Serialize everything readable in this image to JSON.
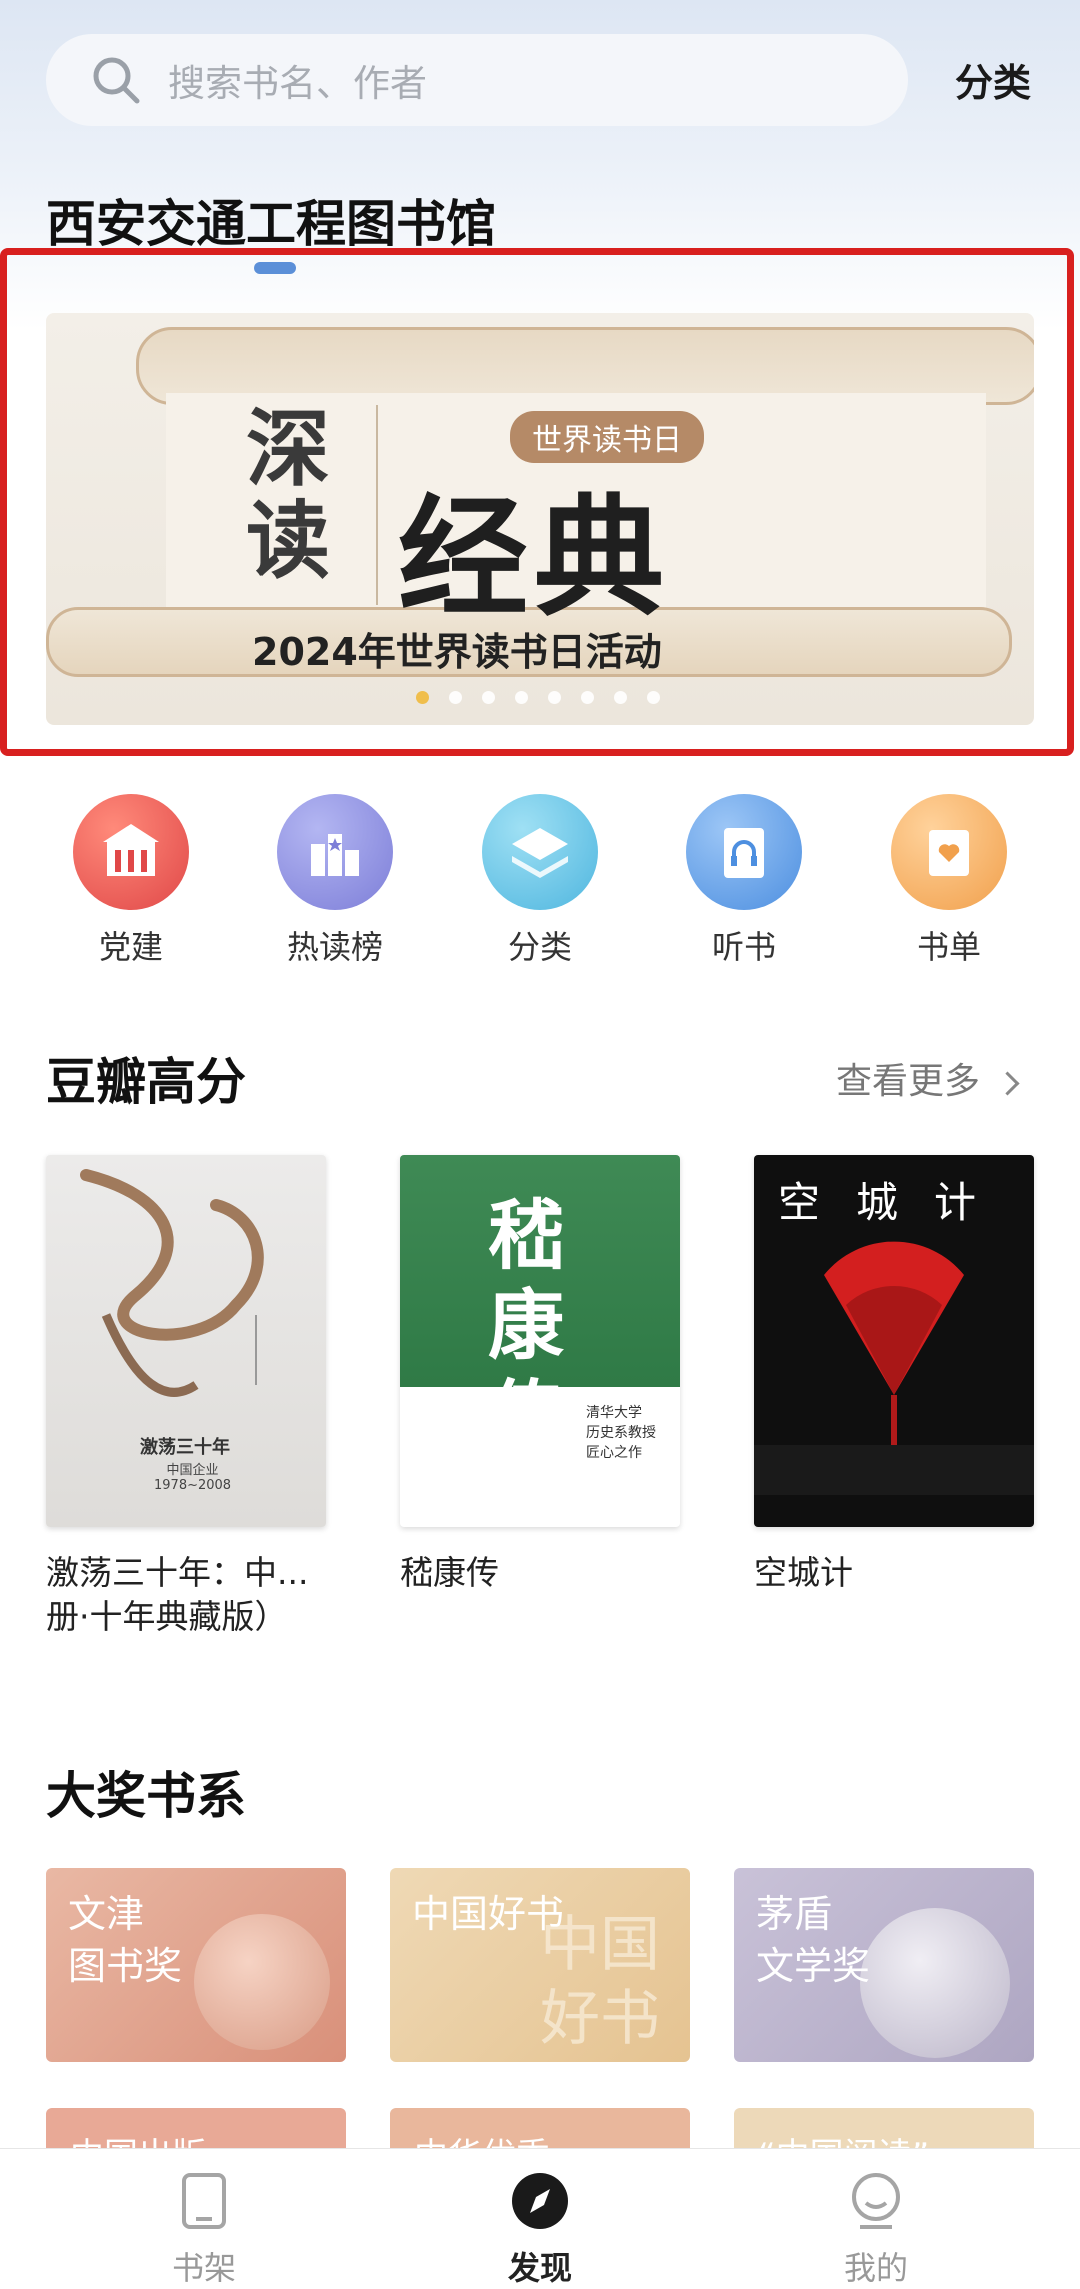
{
  "search": {
    "placeholder": "搜索书名、作者"
  },
  "header": {
    "category_link": "分类",
    "library_title": "西安交通工程图书馆"
  },
  "banner": {
    "vertical_text": "深读",
    "headline": "经典",
    "badge": "世界读书日",
    "caption": "2024年世界读书日活动",
    "page_dots": 8,
    "active_dot": 0
  },
  "shortcuts": [
    {
      "label": "党建",
      "icon": "party-building-icon",
      "color": "#e04848"
    },
    {
      "label": "热读榜",
      "icon": "hot-ranking-icon",
      "color": "#7d7ed8"
    },
    {
      "label": "分类",
      "icon": "layers-icon",
      "color": "#4fb6df"
    },
    {
      "label": "听书",
      "icon": "audiobook-icon",
      "color": "#4d8fe0"
    },
    {
      "label": "书单",
      "icon": "booklist-icon",
      "color": "#f1a04c"
    }
  ],
  "douban": {
    "title": "豆瓣高分",
    "more": "查看更多",
    "books": [
      {
        "title": "激荡三十年：中...\n册·十年典藏版）",
        "cover_text": "激荡三十年",
        "cover_sub": "中国企业\n1978~2008"
      },
      {
        "title": "嵇康传",
        "cover_text": "嵇康传",
        "cover_sub": "清华大学\n历史系教授\n匠心之作"
      },
      {
        "title": "空城计",
        "cover_text": "空城计"
      }
    ]
  },
  "awards": {
    "title": "大奖书系",
    "items": [
      {
        "name": "文津\n图书奖"
      },
      {
        "name": "中国好书",
        "overlay": "中国\n好书"
      },
      {
        "name": "茅盾\n文学奖"
      }
    ],
    "row2": [
      {
        "name": "中国出版"
      },
      {
        "name": "中华优秀"
      },
      {
        "name": "“中国阅读”"
      }
    ]
  },
  "tabbar": {
    "tabs": [
      {
        "label": "书架",
        "icon": "bookshelf-icon"
      },
      {
        "label": "发现",
        "icon": "compass-icon",
        "active": true
      },
      {
        "label": "我的",
        "icon": "profile-icon"
      }
    ]
  }
}
